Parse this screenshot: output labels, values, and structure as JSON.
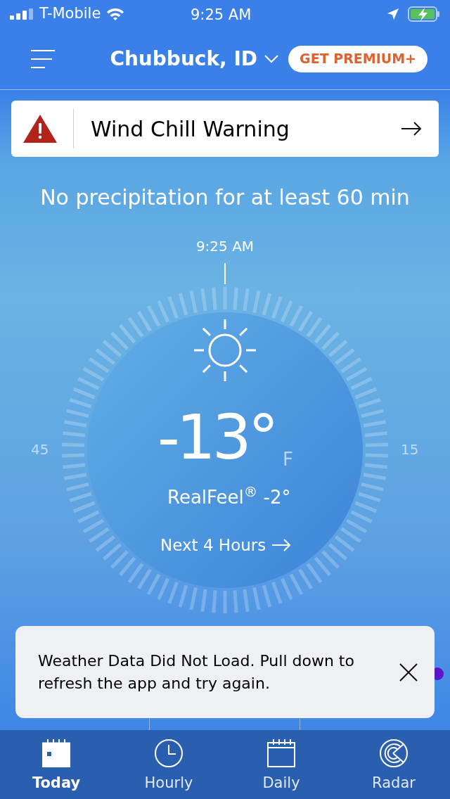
{
  "status_bar": {
    "carrier": "T-Mobile",
    "time": "9:25 AM"
  },
  "header": {
    "location": "Chubbuck, ID",
    "premium_button": "GET PREMIUM+"
  },
  "alert": {
    "title": "Wind Chill Warning"
  },
  "precipitation": "No precipitation for at least 60 min",
  "dial": {
    "time": "9:25 AM",
    "left_value": "45",
    "right_value": "15",
    "temperature": "-13°",
    "unit": "F",
    "realfeel": "RealFeel$^{®}$ -2°",
    "next_link": "Next 4 Hours"
  },
  "toast": {
    "message": "Weather Data Did Not Load. Pull down to refresh the app and try again."
  },
  "tab_bar": [
    {
      "label": "Today",
      "kind": "today",
      "selected": true
    },
    {
      "label": "Hourly",
      "kind": "hourly",
      "selected": false
    },
    {
      "label": "Daily",
      "kind": "daily",
      "selected": false
    },
    {
      "label": "Radar",
      "kind": "radar",
      "selected": false
    }
  ]
}
